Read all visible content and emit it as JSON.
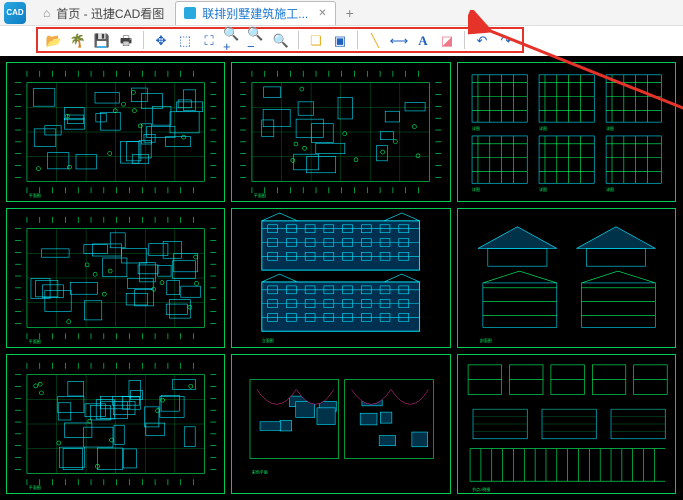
{
  "app": {
    "icon_label": "CAD"
  },
  "tabs": [
    {
      "label": "首页 - 迅捷CAD看图",
      "active": false
    },
    {
      "label": "联排别墅建筑施工...",
      "active": true
    }
  ],
  "toolbar": [
    {
      "name": "open-file",
      "cls": "ic-open",
      "glyph": "📂"
    },
    {
      "name": "tree-view",
      "cls": "ic-tree",
      "glyph": "🌴"
    },
    {
      "name": "save",
      "cls": "ic-save",
      "glyph": "💾"
    },
    {
      "name": "print",
      "cls": "ic-print",
      "glyph": "🖶"
    },
    {
      "name": "sep1",
      "sep": true
    },
    {
      "name": "pan",
      "cls": "ic-pan",
      "glyph": "✥"
    },
    {
      "name": "zoom-window",
      "cls": "ic-window",
      "glyph": "⬚"
    },
    {
      "name": "zoom-select",
      "cls": "ic-select",
      "glyph": "⛶"
    },
    {
      "name": "zoom-in",
      "cls": "ic-zin",
      "glyph": "🔍+"
    },
    {
      "name": "zoom-out",
      "cls": "ic-zout",
      "glyph": "🔍−"
    },
    {
      "name": "zoom-fit",
      "cls": "ic-fit",
      "glyph": "🔍"
    },
    {
      "name": "sep2",
      "sep": true
    },
    {
      "name": "view-3d-iso",
      "cls": "ic-3d1",
      "glyph": "❏"
    },
    {
      "name": "view-3d-box",
      "cls": "ic-3d2",
      "glyph": "▣"
    },
    {
      "name": "sep3",
      "sep": true
    },
    {
      "name": "measure",
      "cls": "ic-meas",
      "glyph": "╲"
    },
    {
      "name": "dimension",
      "cls": "ic-dim",
      "glyph": "⟷"
    },
    {
      "name": "text",
      "cls": "ic-text",
      "glyph": "A"
    },
    {
      "name": "erase",
      "cls": "ic-erase",
      "glyph": "◪"
    },
    {
      "name": "sep4",
      "sep": true
    },
    {
      "name": "undo",
      "cls": "ic-undo",
      "glyph": "↶"
    },
    {
      "name": "redo",
      "cls": "ic-redo",
      "glyph": "↷"
    }
  ],
  "drawings": [
    {
      "type": "plan"
    },
    {
      "type": "plan-simple"
    },
    {
      "type": "details"
    },
    {
      "type": "plan"
    },
    {
      "type": "elevation"
    },
    {
      "type": "section"
    },
    {
      "type": "plan"
    },
    {
      "type": "plan-color"
    },
    {
      "type": "schedules"
    }
  ]
}
